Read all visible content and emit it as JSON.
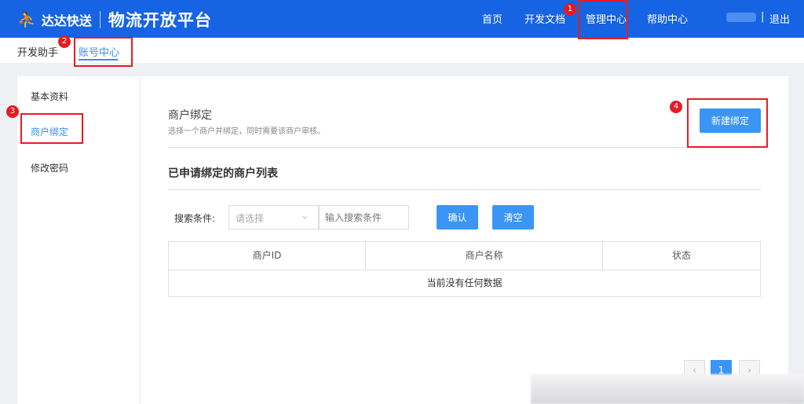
{
  "header": {
    "logo_brand": "达达快送",
    "title": "物流开放平台",
    "nav": [
      "首页",
      "开发文档",
      "管理中心",
      "帮助中心"
    ],
    "logout": "退出",
    "divider": "|"
  },
  "subnav": {
    "items": [
      "开发助手",
      "账号中心"
    ]
  },
  "sidebar": {
    "items": [
      "基本资料",
      "商户绑定",
      "修改密码"
    ]
  },
  "main": {
    "section_title": "商户绑定",
    "section_desc": "选择一个商户并绑定，同时需要该商户审核。",
    "new_button": "新建绑定",
    "list_title": "已申请绑定的商户列表",
    "search": {
      "label": "搜索条件:",
      "select_placeholder": "请选择",
      "input_placeholder": "输入搜索条件",
      "confirm": "确认",
      "clear": "清空"
    },
    "table": {
      "columns": [
        "商户ID",
        "商户名称",
        "状态"
      ],
      "empty": "当前没有任何数据"
    },
    "pagination": {
      "prev": "‹",
      "current": "1",
      "next": "›"
    }
  },
  "annotations": [
    "1",
    "2",
    "3",
    "4"
  ],
  "colors": {
    "header": "#1663e3",
    "accent": "#3b95f4",
    "annotation": "#e51c23"
  }
}
